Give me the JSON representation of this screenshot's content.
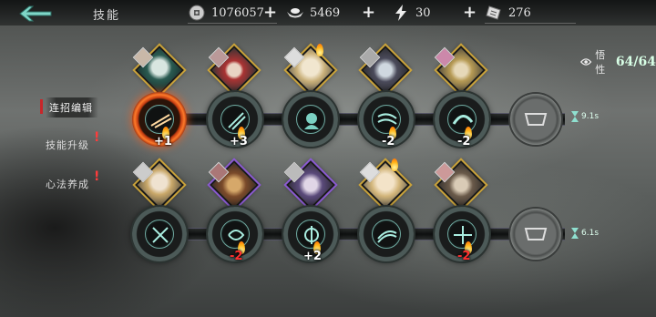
{
  "header": {
    "title": "技能",
    "back_icon": "back-arrow-icon"
  },
  "resources": [
    {
      "name": "coin",
      "icon": "coin-icon",
      "value": "1076057"
    },
    {
      "name": "ingot",
      "icon": "ingot-icon",
      "value": "5469"
    },
    {
      "name": "stamina",
      "icon": "lightning-icon",
      "value": "30"
    },
    {
      "name": "ticket",
      "icon": "ticket-icon",
      "value": "276"
    }
  ],
  "menu": [
    {
      "label": "连招编辑",
      "active": true,
      "alert": false
    },
    {
      "label": "技能升级",
      "active": false,
      "alert": true
    },
    {
      "label": "心法养成",
      "active": false,
      "alert": true
    }
  ],
  "alert_mark": "!",
  "attribute": {
    "label": "悟性",
    "value": "64/64"
  },
  "rows": [
    {
      "cooldown": "9.1s",
      "slots": [
        {
          "badge": "+1",
          "type": "up",
          "frame": "gold",
          "node": "fire"
        },
        {
          "badge": "+3",
          "type": "up",
          "frame": "gold",
          "node": "teal"
        },
        {
          "badge": "",
          "type": "",
          "frame": "gold",
          "node": "teal"
        },
        {
          "badge": "-2",
          "type": "up",
          "frame": "gold",
          "node": "teal"
        },
        {
          "badge": "-2",
          "type": "up",
          "frame": "gold",
          "node": "teal"
        }
      ]
    },
    {
      "cooldown": "6.1s",
      "slots": [
        {
          "badge": "",
          "type": "",
          "frame": "gold",
          "node": "teal"
        },
        {
          "badge": "-2",
          "type": "down",
          "frame": "purple",
          "node": "teal"
        },
        {
          "badge": "+2",
          "type": "up",
          "frame": "purple",
          "node": "teal"
        },
        {
          "badge": "",
          "type": "",
          "frame": "gold",
          "node": "teal"
        },
        {
          "badge": "-2",
          "type": "down",
          "frame": "gold",
          "node": "teal"
        }
      ]
    }
  ],
  "colors": {
    "accent_red": "#c8262a",
    "frame_gold": "#c9a23a",
    "frame_purple": "#8a5ad0",
    "teal": "#6fa9a0"
  }
}
